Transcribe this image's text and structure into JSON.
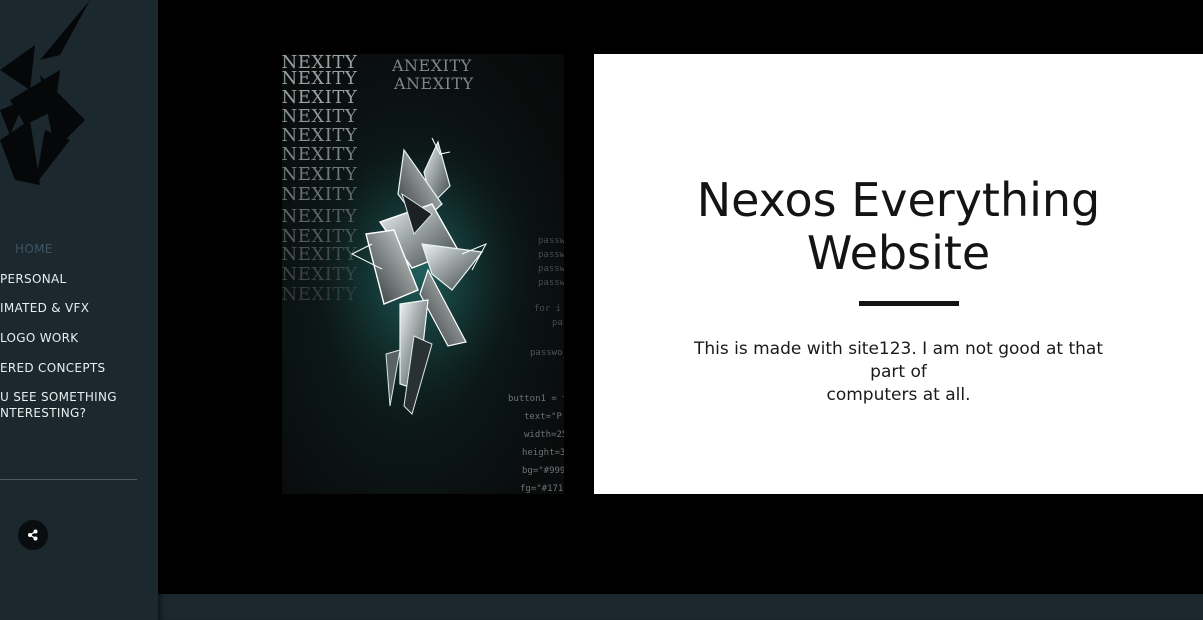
{
  "sidebar": {
    "items": [
      {
        "label": "HOME"
      },
      {
        "label": "PERSONAL"
      },
      {
        "label": "IMATED & VFX"
      },
      {
        "label": "LOGO WORK"
      },
      {
        "label": "ERED CONCEPTS"
      },
      {
        "label": "U SEE SOMETHING"
      },
      {
        "label": "NTERESTING?"
      }
    ],
    "share_icon": "share-icon"
  },
  "hero": {
    "art_text": "ANEXITY",
    "code_lines": [
      "button1 = t",
      "text=\"P",
      "width=25",
      "height=3",
      "bg=\"#999",
      "fg=\"#171",
      "password",
      "passw",
      "passwo",
      "passwo",
      "passwo",
      "for i",
      "pas"
    ]
  },
  "card": {
    "title_line1": "Nexos Everything",
    "title_line2": "Website",
    "text_line1": "This is made with site123. I am not good at that part of",
    "text_line2": "computers at all."
  },
  "colors": {
    "sidebar_bg": "#1b282e",
    "page_bg": "#000000",
    "card_bg": "#ffffff",
    "accent_dark": "#141414"
  }
}
